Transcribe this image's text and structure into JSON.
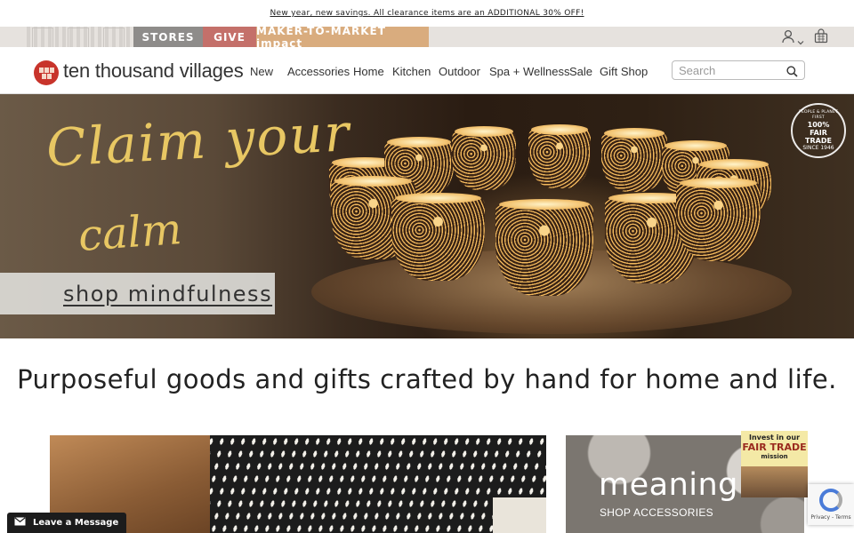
{
  "promo_bar": {
    "text": "New year, new savings. All clearance items are an ADDITIONAL 30% OFF!"
  },
  "utility_bar": {
    "tabs": [
      {
        "label": "STORES",
        "color": "#8e8c8a"
      },
      {
        "label": "GIVE",
        "color": "#c4706a"
      },
      {
        "label": "MAKER-TO-MARKET impact",
        "color": "#d9ac7e"
      }
    ],
    "icons": [
      "account-icon",
      "chevron-down-icon",
      "basket-icon"
    ]
  },
  "header": {
    "logo_text": "ten thousand villages",
    "nav": [
      "New",
      "Accessories",
      "Home",
      "Kitchen",
      "Outdoor",
      "Spa + Wellness",
      "Sale",
      "Gift Shop"
    ],
    "search_placeholder": "Search"
  },
  "hero": {
    "headline_line1": "Claim your",
    "headline_line2": "calm",
    "cta": "shop mindfulness",
    "badge": {
      "arc_top": "PEOPLE & PLANET FIRST",
      "line1": "100%",
      "line2": "FAIR",
      "line3": "TRADE",
      "arc_bottom": "SINCE 1946"
    }
  },
  "tagline": "Purposeful goods and gifts crafted by hand for home and life.",
  "tiles": {
    "right_title": "meaning",
    "right_cta": "SHOP ACCESSORIES",
    "fair_trade_card": {
      "line1": "Invest in our",
      "line2": "FAIR TRADE",
      "line3": "mission"
    }
  },
  "recaptcha": {
    "text": "Privacy - Terms"
  },
  "chat": {
    "label": "Leave a Message"
  },
  "colors": {
    "gold_script": "#e8c763",
    "brand_red": "#c8342b",
    "stores": "#8e8c8a",
    "give": "#c4706a",
    "m2m": "#d9ac7e"
  }
}
